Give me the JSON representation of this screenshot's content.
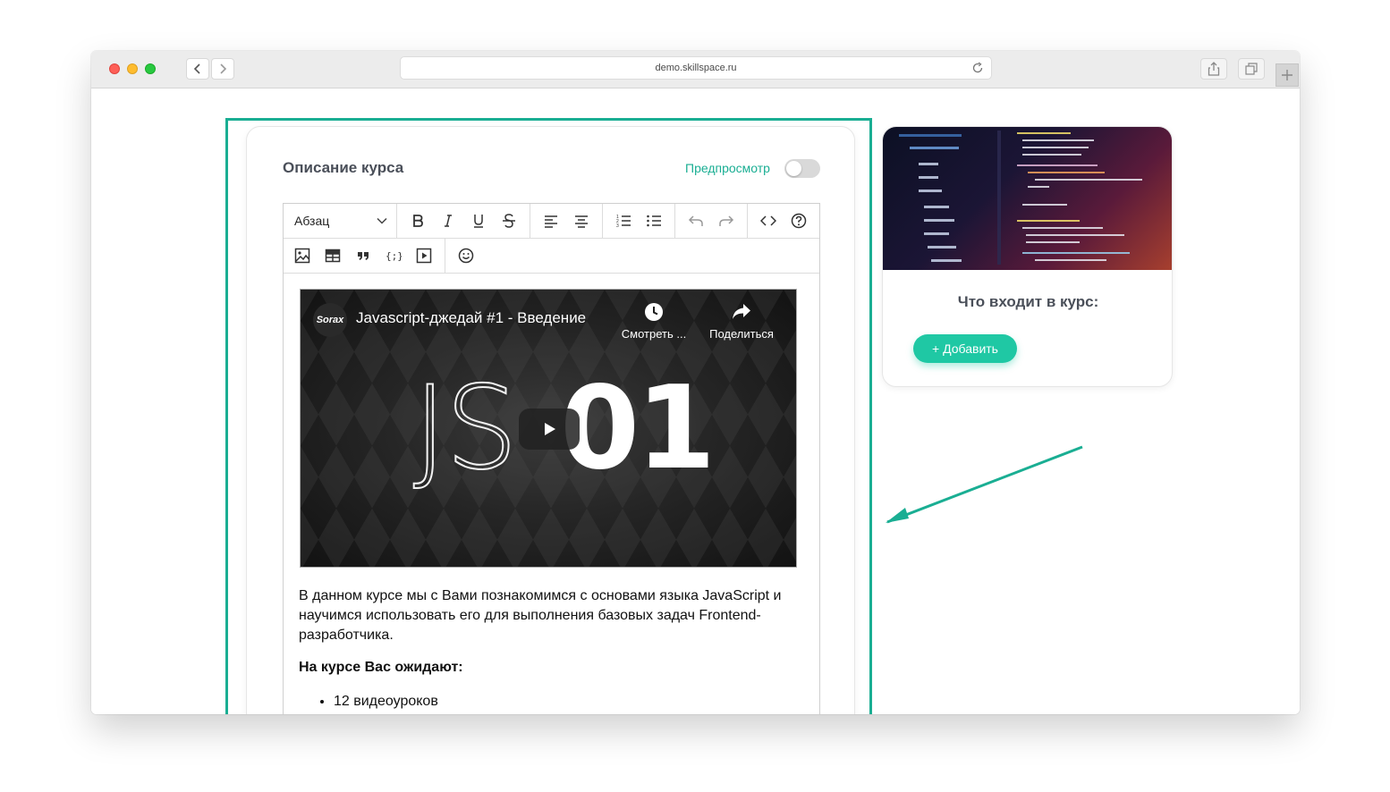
{
  "browser": {
    "url": "demo.skillspace.ru"
  },
  "description_card": {
    "title": "Описание курса",
    "preview_label": "Предпросмотр",
    "preview_enabled": false
  },
  "editor": {
    "paragraph_select": "Абзац",
    "toolbar_row1": [
      "bold-icon",
      "italic-icon",
      "underline-icon",
      "strikethrough-icon",
      "align-left-icon",
      "align-center-icon",
      "ordered-list-icon",
      "bullet-list-icon",
      "undo-icon",
      "redo-icon",
      "code-icon",
      "help-icon"
    ],
    "toolbar_row2": [
      "image-icon",
      "table-icon",
      "quote-icon",
      "code-block-icon",
      "video-icon",
      "emoji-icon"
    ]
  },
  "video": {
    "channel": "Sorax",
    "title": "Javascript-джедай #1 - Введение",
    "watch_later": "Смотреть ...",
    "share": "Поделиться",
    "thumb_left": "JS",
    "thumb_right": "01"
  },
  "content": {
    "paragraph": "В данном курсе мы с Вами познакомимся с основами языка JavaScript и научимся использовать его для выполнения базовых задач Frontend-разработчика.",
    "heading": "На курсе Вас ожидают:",
    "bullets": [
      "12 видеоуроков"
    ]
  },
  "side_card": {
    "title": "Что входит в курс:",
    "add_button": "+ Добавить"
  },
  "colors": {
    "accent": "#1aae93",
    "button": "#1fc8a4"
  }
}
